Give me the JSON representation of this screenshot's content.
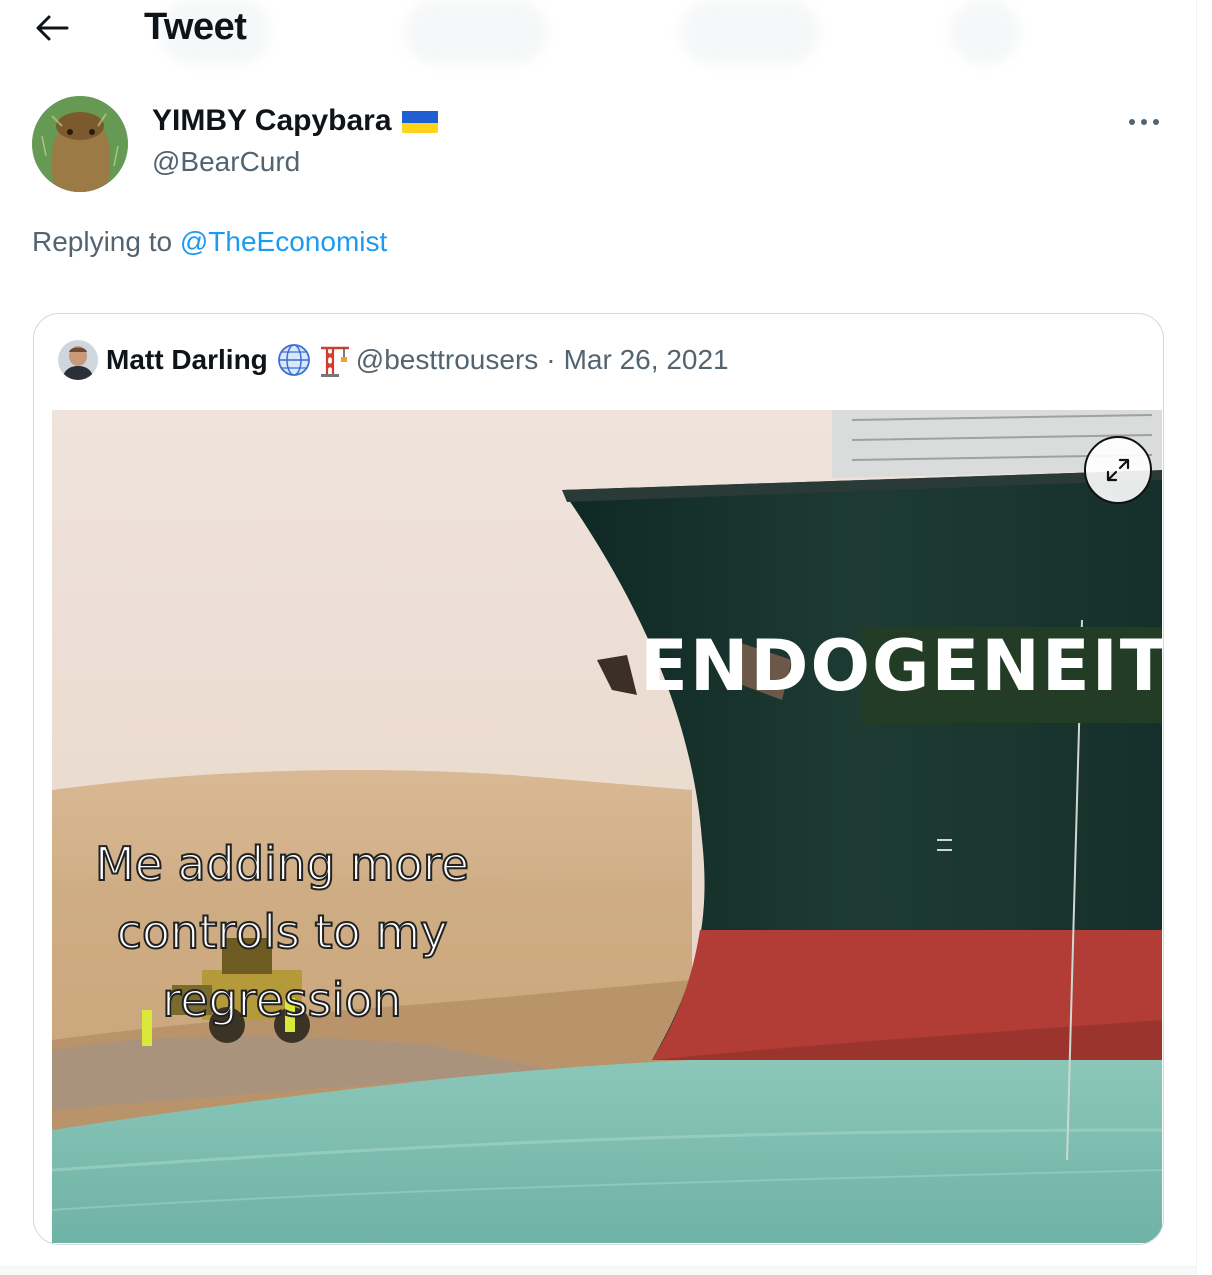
{
  "header": {
    "title": "Tweet"
  },
  "tweet": {
    "author_name": "YIMBY Capybara",
    "author_handle": "@BearCurd",
    "replying_prefix": "Replying to ",
    "replying_to": "@TheEconomist"
  },
  "quoted": {
    "author_name": "Matt Darling",
    "author_handle": "@besttrousers",
    "separator": "·",
    "date": "Mar 26, 2021",
    "meme": {
      "ship_label": "ENDOGENEITY",
      "me_label": "Me adding more controls to my regression"
    }
  },
  "icons": [
    "back-arrow-icon",
    "ukraine-flag-icon",
    "more-icon",
    "globe-icon",
    "crane-icon",
    "expand-icon"
  ],
  "colors": {
    "link": "#1d9bf0",
    "secondary_text": "#536471",
    "border": "#cfd9de"
  }
}
